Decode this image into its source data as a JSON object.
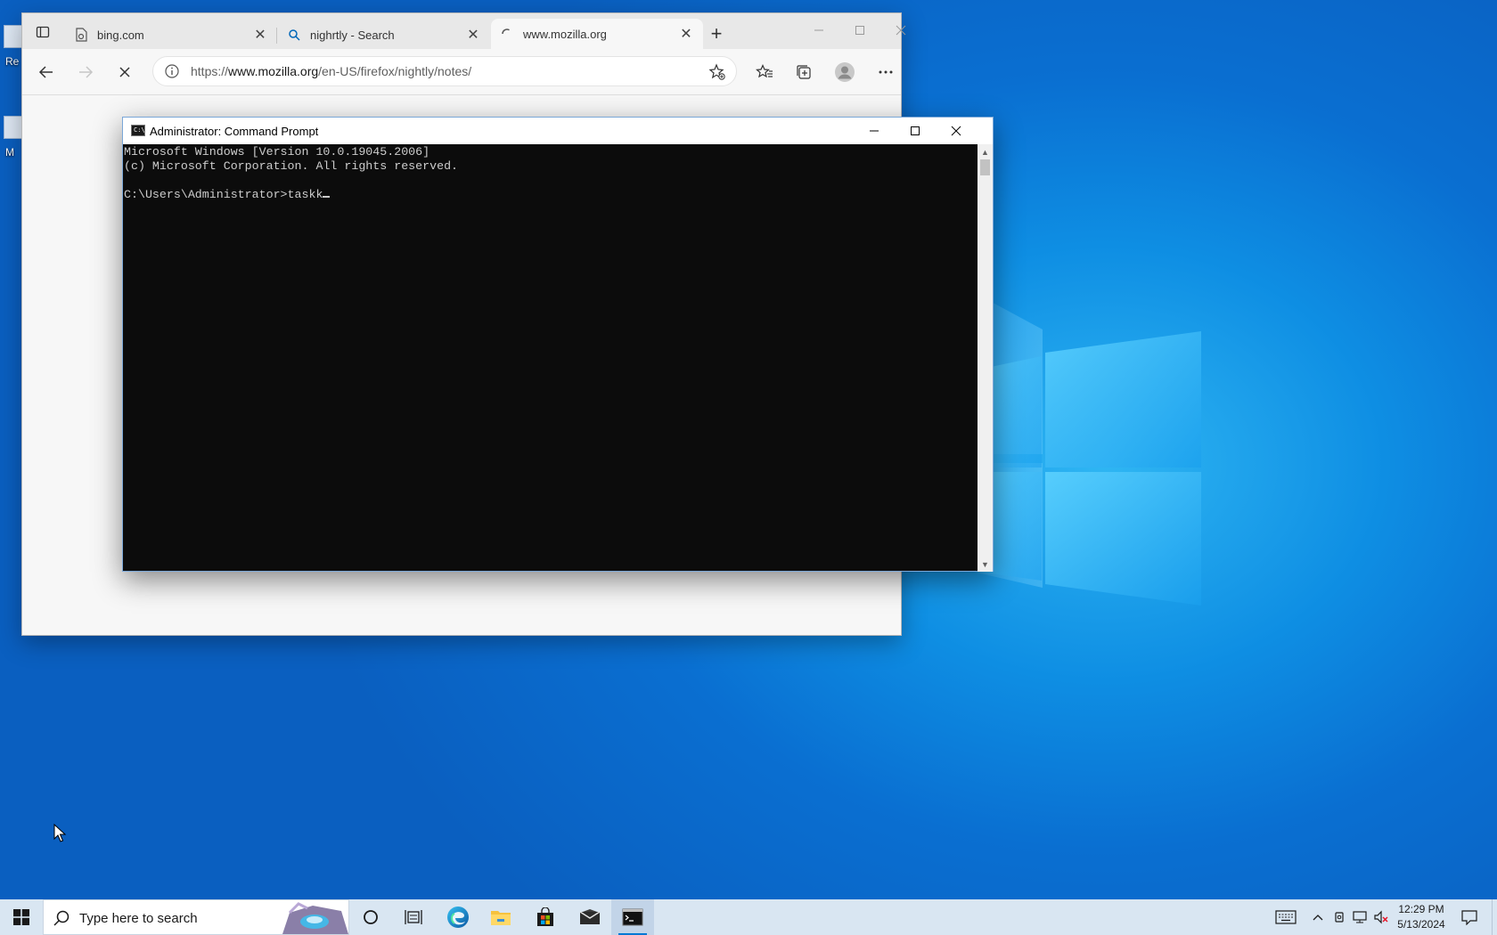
{
  "browser": {
    "tabs": [
      {
        "title": "bing.com",
        "favicon": "bing-page-icon"
      },
      {
        "title": "nighrtly - Search",
        "favicon": "search-icon"
      },
      {
        "title": "www.mozilla.org",
        "favicon": "loading-spinner-icon",
        "active": true
      }
    ],
    "address": {
      "prefix": "https://",
      "host": "www.mozilla.org",
      "path": "/en-US/firefox/nightly/notes/"
    }
  },
  "cmd": {
    "title": "Administrator: Command Prompt",
    "icon_glyph": "C:\\_",
    "lines": [
      "Microsoft Windows [Version 10.0.19045.2006]",
      "(c) Microsoft Corporation. All rights reserved.",
      "",
      "C:\\Users\\Administrator>taskk"
    ]
  },
  "taskbar": {
    "search_placeholder": "Type here to search",
    "pinned": [
      "cortana-icon",
      "task-view-icon",
      "edge-icon",
      "file-explorer-icon",
      "store-icon",
      "mail-icon",
      "command-prompt-icon"
    ],
    "clock": {
      "time": "12:29 PM",
      "date": "5/13/2024"
    }
  },
  "desktop": {
    "icons": [
      {
        "label": "Re"
      },
      {
        "label": "M"
      }
    ]
  },
  "colors": {
    "desktop_blue": "#0a6fd1",
    "accent": "#0078d4",
    "console_bg": "#0c0c0c",
    "console_text": "#cccccc"
  }
}
